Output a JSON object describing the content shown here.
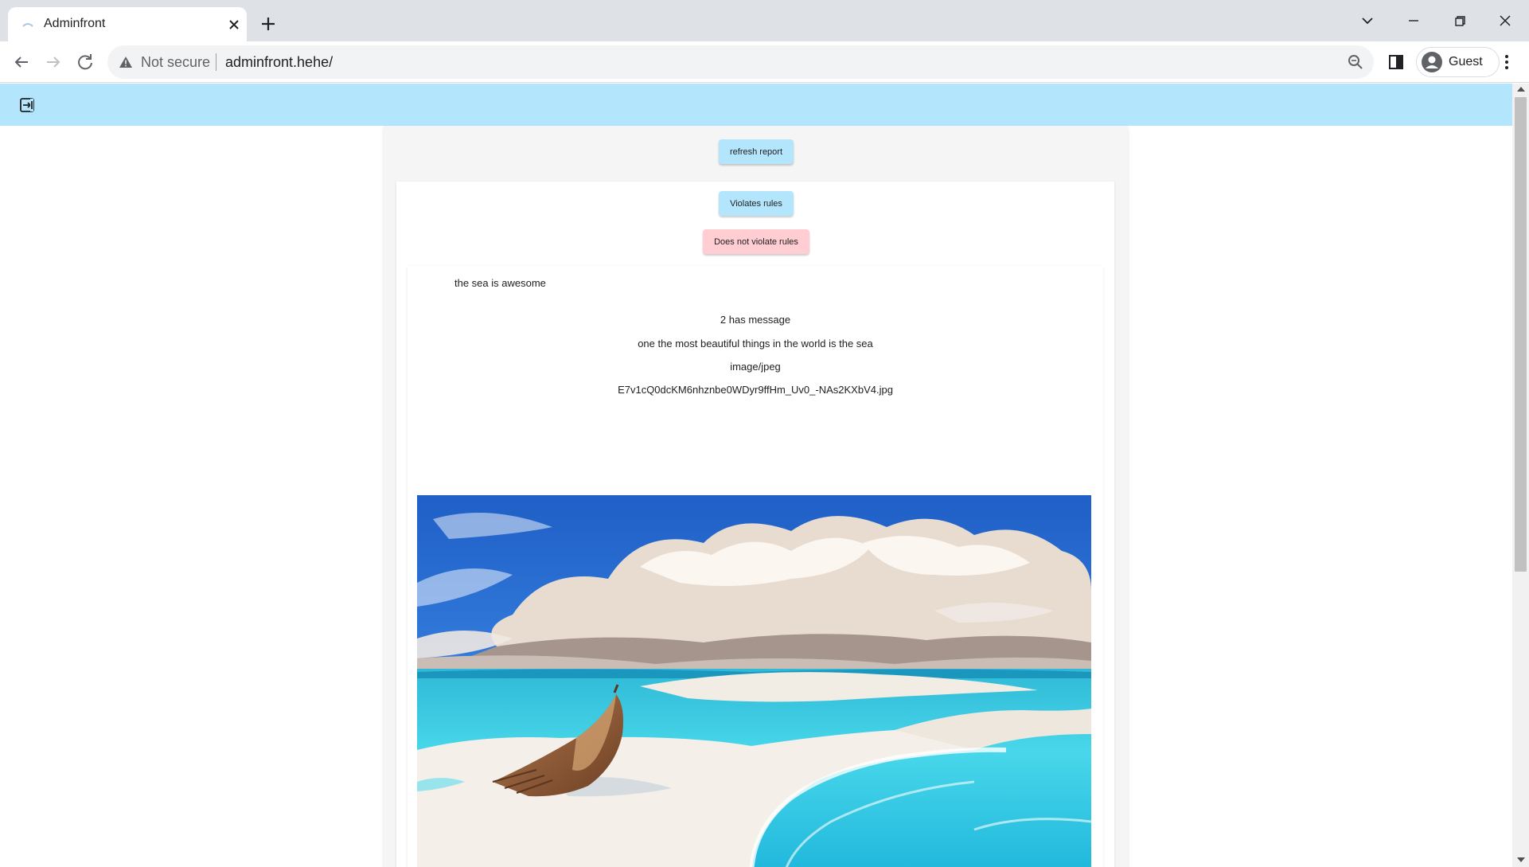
{
  "browser": {
    "tab_title": "Adminfront",
    "not_secure_label": "Not secure",
    "url": "adminfront.hehe/",
    "profile_name": "Guest"
  },
  "report": {
    "refresh_label": "refresh report",
    "violates_label": "Violates rules",
    "not_violate_label": "Does not violate rules",
    "post_text": "the sea is awesome",
    "message_count": "2 has message",
    "message": "one the most beautiful things in the world is the sea",
    "mime_type": "image/jpeg",
    "filename": "E7v1cQ0dcKM6nhznbe0WDyr9ffHm_Uv0_-NAs2KXbV4.jpg"
  },
  "image": {
    "subject": "painted beach with wrecked wooden boat on white sand, turquoise sea and cumulus clouds",
    "colors": {
      "sky": "#1f63c9",
      "cloud": "#e8ddd3",
      "sea": "#38d3e6",
      "sand": "#f4efe8",
      "boat": "#8a5634"
    }
  },
  "colors": {
    "appbar": "#b3e5fc",
    "primary_button": "#b3e5fc",
    "danger_button": "#ffcdd2"
  },
  "icons": [
    "logout-icon",
    "back-icon",
    "forward-icon",
    "reload-icon",
    "warning-icon",
    "zoom-icon",
    "side-panel-icon",
    "profile-icon",
    "menu-icon"
  ]
}
